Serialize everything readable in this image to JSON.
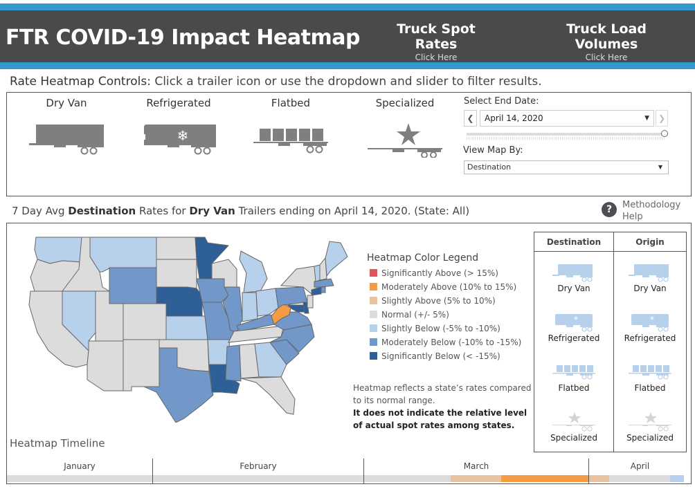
{
  "header": {
    "title": "FTR COVID-19 Impact Heatmap",
    "nav": [
      {
        "label": "Truck Spot Rates",
        "sub": "Click Here"
      },
      {
        "label": "Truck Load Volumes",
        "sub": "Click Here"
      }
    ]
  },
  "controls": {
    "heading_bold": "Rate Heatmap Controls:",
    "heading_rest": " Click a trailer icon or use the dropdown and slider to filter results.",
    "trailers": [
      {
        "label": "Dry Van",
        "icon": "dry-van-trailer-icon"
      },
      {
        "label": "Refrigerated",
        "icon": "refrigerated-trailer-icon"
      },
      {
        "label": "Flatbed",
        "icon": "flatbed-trailer-icon"
      },
      {
        "label": "Specialized",
        "icon": "specialized-trailer-icon"
      }
    ],
    "date_label": "Select End Date:",
    "date_value": "April 14, 2020",
    "prev_glyph": "❮",
    "next_glyph": "❯",
    "caret_glyph": "▼",
    "slider_position": 1.0,
    "viewby_label": "View Map By:",
    "viewby_value": "Destination"
  },
  "map_section": {
    "heading": {
      "p1": "7 Day Avg ",
      "b1": "Destination",
      "p2": " Rates for ",
      "b2": "Dry Van",
      "p3": " Trailers ending on April 14, 2020. (State: All)"
    },
    "help_label": "Methodology Help",
    "help_glyph": "?",
    "legend": {
      "title": "Heatmap Color Legend",
      "items": [
        {
          "label": "Significantly Above (> 15%)",
          "color": "#e0545a"
        },
        {
          "label": "Moderately Above (10% to 15%)",
          "color": "#f39c45"
        },
        {
          "label": "Slightly Above (5% to 10%)",
          "color": "#e9c3a0"
        },
        {
          "label": "Normal (+/- 5%)",
          "color": "#dcdcdc"
        },
        {
          "label": "Slightly Below (-5% to -10%)",
          "color": "#b7d0ec"
        },
        {
          "label": "Moderately Below (-10% to -15%)",
          "color": "#7298c9"
        },
        {
          "label": "Significantly Below (< -15%)",
          "color": "#2f5f97"
        }
      ]
    },
    "note_line1": "Heatmap reflects a state’s rates compared to its normal range.",
    "note_bold": "It does not indicate the relative level of actual spot rates among states.",
    "states": {
      "WA": "slightly_below",
      "OR": "normal",
      "CA": "normal",
      "ID": "normal",
      "NV": "slightly_below",
      "MT": "slightly_below",
      "WY": "moderately_below",
      "UT": "normal",
      "AZ": "normal",
      "CO": "normal",
      "NM": "normal",
      "ND": "normal",
      "SD": "normal",
      "NE": "significantly_below",
      "KS": "slightly_below",
      "OK": "normal",
      "TX": "moderately_below",
      "MN": "significantly_below",
      "IA": "moderately_below",
      "MO": "moderately_below",
      "AR": "slightly_below",
      "LA": "significantly_below",
      "WI": "normal",
      "IL": "moderately_below",
      "MI": "slightly_below",
      "IN": "slightly_below",
      "OH": "slightly_below",
      "KY": "moderately_below",
      "TN": "normal",
      "MS": "moderately_below",
      "AL": "normal",
      "GA": "slightly_below",
      "FL": "normal",
      "SC": "moderately_below",
      "NC": "moderately_below",
      "VA": "moderately_below",
      "WV": "moderately_above",
      "PA": "moderately_below",
      "NY": "normal",
      "MD": "significantly_below",
      "DE": "significantly_below",
      "NJ": "normal",
      "CT": "significantly_below",
      "MA": "moderately_below",
      "RI": "moderately_below",
      "VT": "slightly_below",
      "NH": "normal",
      "ME": "slightly_below"
    },
    "selector": {
      "headers": [
        "Destination",
        "Origin"
      ],
      "items": [
        "Dry Van",
        "Refrigerated",
        "Flatbed",
        "Specialized"
      ]
    }
  },
  "timeline": {
    "title": "Heatmap Timeline",
    "months": [
      "January",
      "February",
      "March",
      "April"
    ],
    "segments": [
      {
        "from": "Jan 1",
        "to": "Mar 12",
        "level": "normal"
      },
      {
        "from": "Mar 13",
        "to": "Mar 19",
        "level": "slightly_above"
      },
      {
        "from": "Mar 20",
        "to": "Mar 31",
        "level": "moderately_above"
      },
      {
        "from": "Apr 1",
        "to": "Apr 3",
        "level": "slightly_above"
      },
      {
        "from": "Apr 4",
        "to": "Apr 12",
        "level": "normal"
      },
      {
        "from": "Apr 13",
        "to": "Apr 14",
        "level": "slightly_below"
      }
    ]
  }
}
